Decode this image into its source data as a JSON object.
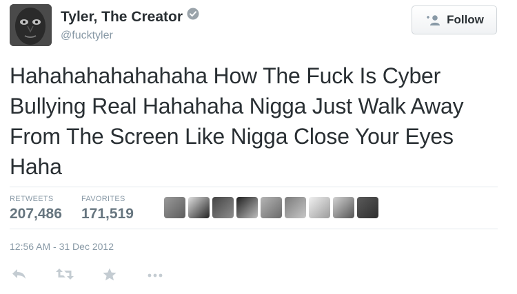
{
  "user": {
    "display_name": "Tyler, The Creator",
    "handle": "@fucktyler",
    "verified": true
  },
  "follow_button": {
    "label": "Follow",
    "icon": "add-user-icon"
  },
  "tweet": {
    "text": "Hahahahahahahaha How The Fuck Is Cyber Bullying Real Hahahaha Nigga Just Walk Away From The Screen Like Nigga Close Your Eyes Haha",
    "timestamp": "12:56 AM - 31 Dec 2012"
  },
  "stats": {
    "retweets_label": "RETWEETS",
    "retweets_value": "207,486",
    "favorites_label": "FAVORITES",
    "favorites_value": "171,519"
  },
  "favoriters_count_shown": 9,
  "actions": [
    {
      "icon": "reply-icon"
    },
    {
      "icon": "retweet-icon"
    },
    {
      "icon": "favorite-star-icon"
    },
    {
      "icon": "more-dots-icon"
    }
  ],
  "colors": {
    "text_dark": "#292f33",
    "text_gray": "#8899a6",
    "divider": "#e1e8ed"
  }
}
